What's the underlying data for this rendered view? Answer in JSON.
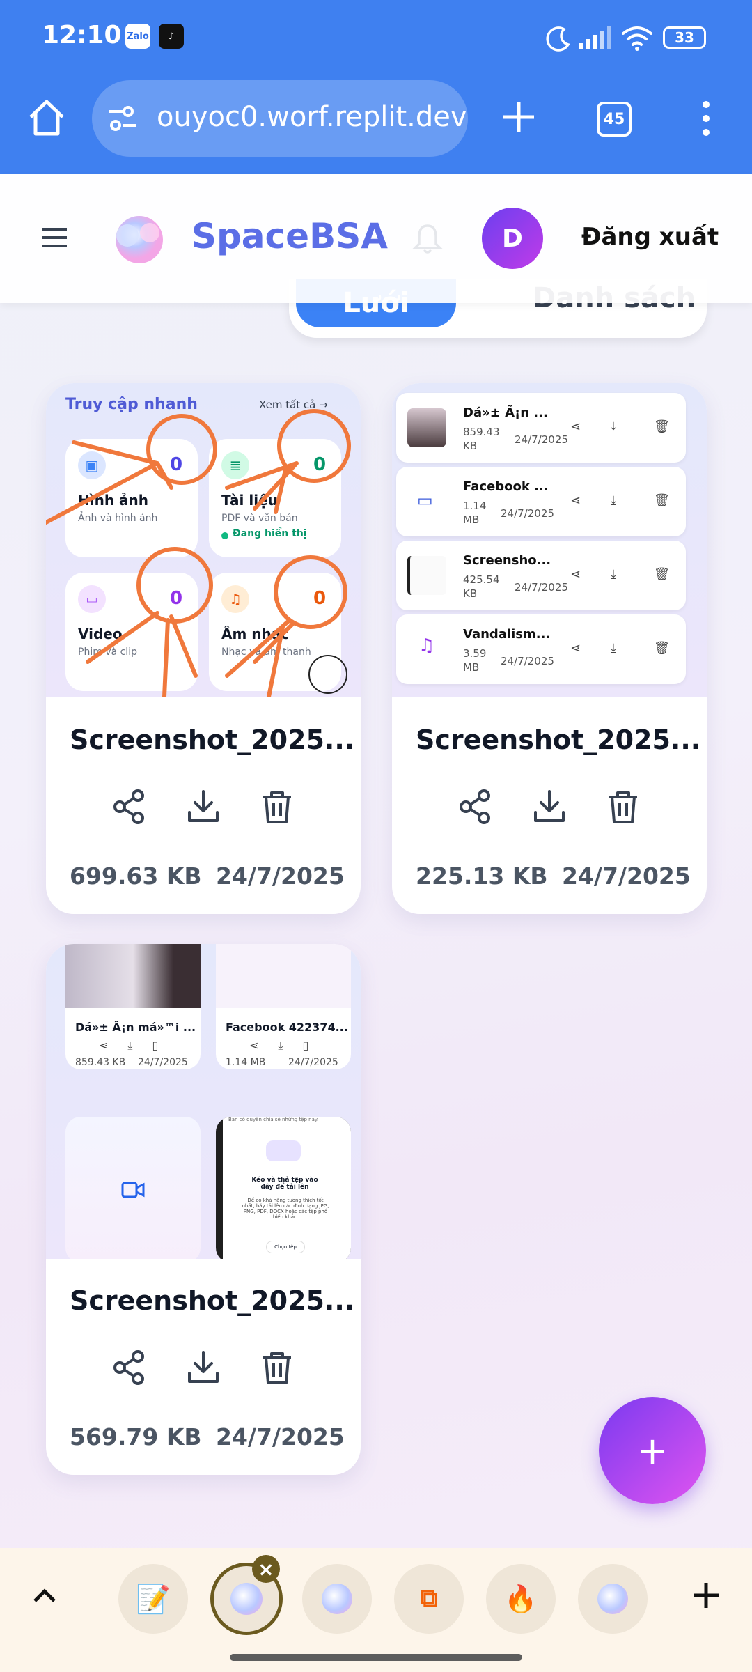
{
  "status": {
    "time": "12:10",
    "battery": "33",
    "apps": [
      "Zalo"
    ]
  },
  "browser": {
    "url": "ouyoc0.worf.replit.dev",
    "tab_count": "45"
  },
  "header": {
    "brand": "SpaceBSA",
    "avatar_initial": "D",
    "logout": "Đăng xuất"
  },
  "view_toggle": {
    "grid": "Lưới",
    "list": "Danh sách"
  },
  "cards": [
    {
      "name": "Screenshot_2025...",
      "size": "699.63 KB",
      "date": "24/7/2025"
    },
    {
      "name": "Screenshot_2025...",
      "size": "225.13 KB",
      "date": "24/7/2025"
    },
    {
      "name": "Screenshot_2025...",
      "size": "569.79 KB",
      "date": "24/7/2025"
    }
  ],
  "preview1": {
    "title": "Truy cập nhanh",
    "see_all": "Xem tất cả →",
    "tiles": [
      {
        "title": "Hình ảnh",
        "subtitle": "Ảnh và hình ảnh",
        "count": "0"
      },
      {
        "title": "Tài liệu",
        "subtitle": "PDF và văn bản",
        "count": "0",
        "status": "Đang hiển thị"
      },
      {
        "title": "Video",
        "subtitle": "Phim và clip",
        "count": "0"
      },
      {
        "title": "Âm nhạc",
        "subtitle": "Nhạc và âm thanh",
        "count": "0"
      }
    ]
  },
  "preview2": {
    "rows": [
      {
        "name": "Dá»± Ã¡n ...",
        "size": "859.43 KB",
        "date": "24/7/2025"
      },
      {
        "name": "Facebook ...",
        "size": "1.14 MB",
        "date": "24/7/2025"
      },
      {
        "name": "Screensho...",
        "size": "425.54 KB",
        "date": "24/7/2025"
      },
      {
        "name": "Vandalism...",
        "size": "3.59 MB",
        "date": "24/7/2025"
      }
    ]
  },
  "preview3": {
    "items": [
      {
        "name": "Dá»± Ã¡n má»™i ...",
        "size": "859.43 KB",
        "date": "24/7/2025"
      },
      {
        "name": "Facebook 422374...",
        "size": "1.14 MB",
        "date": "24/7/2025"
      }
    ],
    "upload_hint": "Bạn có quyền chia sẻ những tệp này.",
    "upload_title": "Kéo và thả tệp vào đây để tải lên",
    "upload_desc": "Để có khả năng tương thích tốt nhất, hãy tải lên các định dạng JPG, PNG, PDF, DOCX hoặc các tệp phổ biến khác.",
    "upload_btn": "Chọn tệp"
  },
  "colors": {
    "accent": "#3b82f6",
    "topbar": "#3f80f0",
    "fab": "#a044f0"
  }
}
